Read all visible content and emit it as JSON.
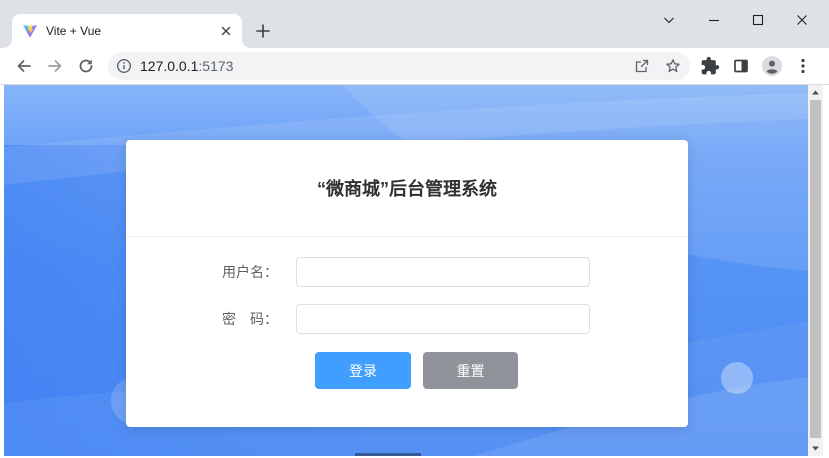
{
  "browser": {
    "tab": {
      "title": "Vite + Vue",
      "favicon": "vite-logo-icon",
      "close_icon": "tab-close-icon"
    },
    "new_tab_icon": "plus-icon",
    "window_controls": {
      "tab_search_icon": "chevron-down-icon",
      "minimize_icon": "minimize-icon",
      "maximize_icon": "maximize-icon",
      "close_icon": "window-close-icon"
    },
    "navigation": {
      "back_icon": "arrow-left-icon",
      "forward_icon": "arrow-right-icon",
      "reload_icon": "reload-icon"
    },
    "address_bar": {
      "security_icon": "info-icon",
      "host": "127.0.0.1",
      "port": ":5173",
      "share_icon": "share-icon",
      "bookmark_icon": "star-icon"
    },
    "toolbar_icons": {
      "extensions": "puzzle-icon",
      "side_panel": "side-panel-icon",
      "profile": "avatar-icon",
      "menu": "more-vertical-icon"
    },
    "colors": {
      "tabstrip": "#dee1e6",
      "omnibox": "#f1f3f4",
      "icon": "#5f6368",
      "icon_disabled": "#9aa0a6"
    }
  },
  "page": {
    "title": "“微商城”后台管理系统",
    "login_form": {
      "username": {
        "label": "用户名：",
        "value": "",
        "placeholder": ""
      },
      "password": {
        "label": "密　码：",
        "value": "",
        "placeholder": ""
      },
      "login_button": {
        "label": "登录",
        "color": "#409eff"
      },
      "reset_button": {
        "label": "重置",
        "color": "#909399"
      }
    },
    "colors": {
      "background": "#5b96f6",
      "card": "#ffffff",
      "title_text": "#303133",
      "label_text": "#606266",
      "input_border": "#dcdfe6"
    }
  }
}
